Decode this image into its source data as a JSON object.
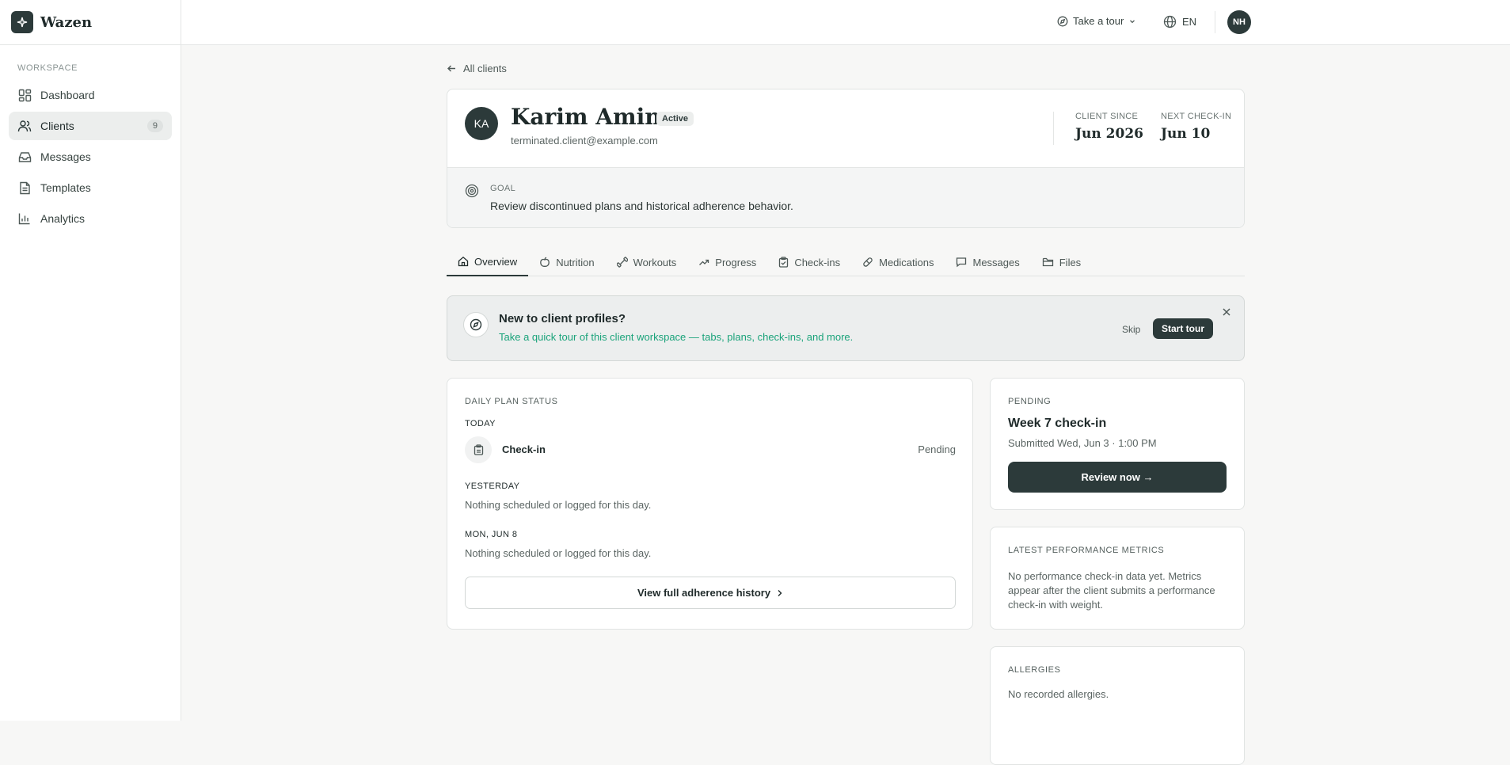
{
  "app": {
    "name": "Wazen"
  },
  "sidebar": {
    "section_label": "WORKSPACE",
    "items": [
      {
        "label": "Dashboard",
        "icon": "dashboard-icon"
      },
      {
        "label": "Clients",
        "icon": "users-icon",
        "count": "9",
        "active": true
      },
      {
        "label": "Messages",
        "icon": "inbox-icon"
      },
      {
        "label": "Templates",
        "icon": "document-icon"
      },
      {
        "label": "Analytics",
        "icon": "bar-chart-icon"
      }
    ]
  },
  "topbar": {
    "tour_label": "Take a tour",
    "language": "EN",
    "user_initials": "NH"
  },
  "back_link": "All clients",
  "client": {
    "initials": "KA",
    "name": "Karim Amin",
    "status": "Active",
    "email": "terminated.client@example.com",
    "client_since_label": "CLIENT SINCE",
    "client_since": "Jun 2026",
    "next_checkin_label": "NEXT CHECK-IN",
    "next_checkin": "Jun 10",
    "goal_label": "GOAL",
    "goal": "Review discontinued plans and historical adherence behavior."
  },
  "tabs": [
    {
      "label": "Overview",
      "icon": "home-icon"
    },
    {
      "label": "Nutrition",
      "icon": "apple-icon"
    },
    {
      "label": "Workouts",
      "icon": "dumbbell-icon"
    },
    {
      "label": "Progress",
      "icon": "trend-icon"
    },
    {
      "label": "Check-ins",
      "icon": "clipboard-icon"
    },
    {
      "label": "Medications",
      "icon": "pill-icon"
    },
    {
      "label": "Messages",
      "icon": "chat-icon"
    },
    {
      "label": "Files",
      "icon": "folder-icon"
    }
  ],
  "tour_banner": {
    "title": "New to client profiles?",
    "subtitle": "Take a quick tour of this client workspace — tabs, plans, check-ins, and more.",
    "skip_label": "Skip",
    "start_label": "Start tour"
  },
  "daily_plan": {
    "label": "DAILY PLAN STATUS",
    "today_label": "TODAY",
    "checkin_name": "Check-in",
    "checkin_status": "Pending",
    "yesterday_label": "YESTERDAY",
    "yesterday_text": "Nothing scheduled or logged for this day.",
    "mon_label": "MON, JUN 8",
    "mon_text": "Nothing scheduled or logged for this day.",
    "history_button": "View full adherence history"
  },
  "pending": {
    "label": "PENDING",
    "title": "Week 7 check-in",
    "submitted": "Submitted Wed, Jun 3 · 1:00 PM",
    "review_button": "Review now →"
  },
  "metrics": {
    "label": "LATEST PERFORMANCE METRICS",
    "text": "No performance check-in data yet. Metrics appear after the client submits a performance check-in with weight."
  },
  "allergies": {
    "label": "ALLERGIES",
    "text": "No recorded allergies."
  }
}
